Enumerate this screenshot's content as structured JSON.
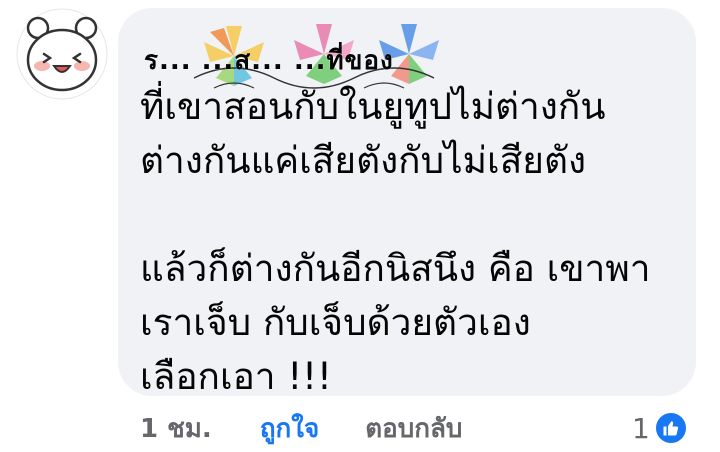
{
  "comment": {
    "author_name": "ร... ...ส... ...ที่ของ",
    "text": "ที่เขาสอนกับในยูทูปไม่ต่างกัน\nต่างกันแค่เสียตังกับไม่เสียตัง\n\nแล้วก็ต่างกันอีกนิสนึง คือ เขาพา\nเราเจ็บ กับเจ็บด้วยตัวเอง\nเลือกเอา !!!",
    "avatar_icon": "cartoon-bear-avatar",
    "flower_decoration_icon": "flower-decoration-icon"
  },
  "actions": {
    "time": "1 ชม.",
    "like_label": "ถูกใจ",
    "reply_label": "ตอบกลับ"
  },
  "reactions": {
    "count": "1",
    "icon": "thumbs-up-icon",
    "color": "#1877f2"
  },
  "colors": {
    "bubble_bg": "#f0f2f5",
    "link_blue": "#1877f2",
    "secondary_text": "#65676b"
  }
}
